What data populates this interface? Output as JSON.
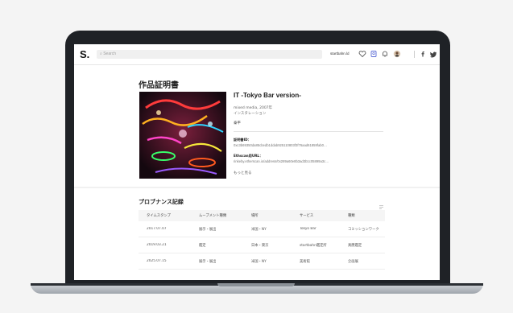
{
  "topbar": {
    "logo": "S.",
    "search_placeholder": "Search",
    "user_name": "startbahn.ld",
    "icons": [
      "heart-icon",
      "certificate-icon",
      "bell-icon",
      "avatar",
      "facebook-icon",
      "twitter-icon"
    ]
  },
  "page": {
    "title": "作品証明書"
  },
  "artwork": {
    "title": "IT -Tokyo Bar version-",
    "meta_line1": "mixed media, 2007年",
    "meta_line2": "インスタレーション",
    "artist": "泰平"
  },
  "fields": {
    "cert_label": "証明書ID：",
    "cert_value": "0xc3b69350da85cbedb1ddab925110803f3f76aad61859fab0…",
    "eth_label": "Ethscan用URL：",
    "eth_value": "rinkeby.etherscan.io/address/0x289a60e8b3ad3b1c05899a3c…",
    "more_link": "もっと見る"
  },
  "provenance": {
    "title": "プロブナンス記録",
    "columns": [
      "タイムスタンプ",
      "ムーブメント種類",
      "場所",
      "サービス",
      "種類"
    ],
    "rows": [
      [
        "2017.07.07",
        "展示・展出",
        "米国・NY",
        "Tokyo Bar",
        "コミッションワーク"
      ],
      [
        "2019.03.21",
        "鑑定",
        "日本・東京",
        "startbahn鑑定所",
        "真贋鑑定"
      ],
      [
        "2025.07.15",
        "展示・展出",
        "米国・NY",
        "美術館",
        "企画展"
      ]
    ]
  },
  "colors": {
    "lid": "#1f2226",
    "accent_certificate_icon": "#5b6bd6"
  }
}
